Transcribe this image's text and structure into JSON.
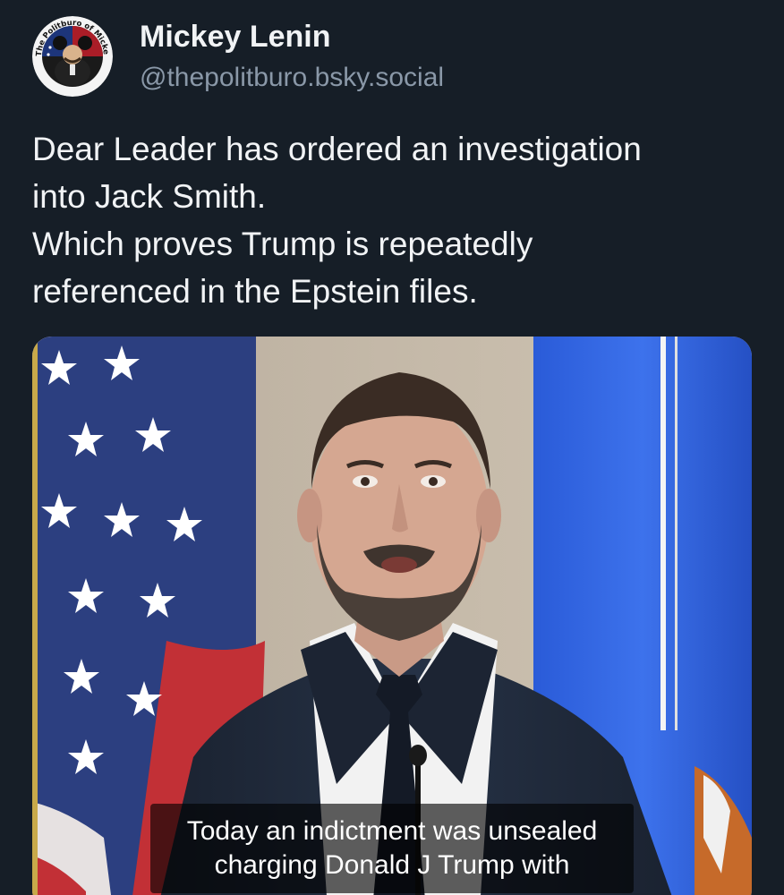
{
  "author": {
    "display_name": "Mickey Lenin",
    "handle": "@thepolitburo.bsky.social",
    "avatar_icon": "politburo-mickey-avatar",
    "avatar_ring_text": "The Politburo of Mickey Mockery"
  },
  "post": {
    "lines": [
      "Dear Leader has ordered an investigation",
      "into Jack Smith.",
      "Which proves Trump is repeatedly",
      "referenced in the Epstein files."
    ]
  },
  "media": {
    "caption_lines": [
      "Today an indictment was unsealed",
      "charging Donald J Trump with"
    ]
  },
  "colors": {
    "background": "#161e27",
    "text_primary": "#f1f3f5",
    "text_secondary": "#8a98a8"
  }
}
